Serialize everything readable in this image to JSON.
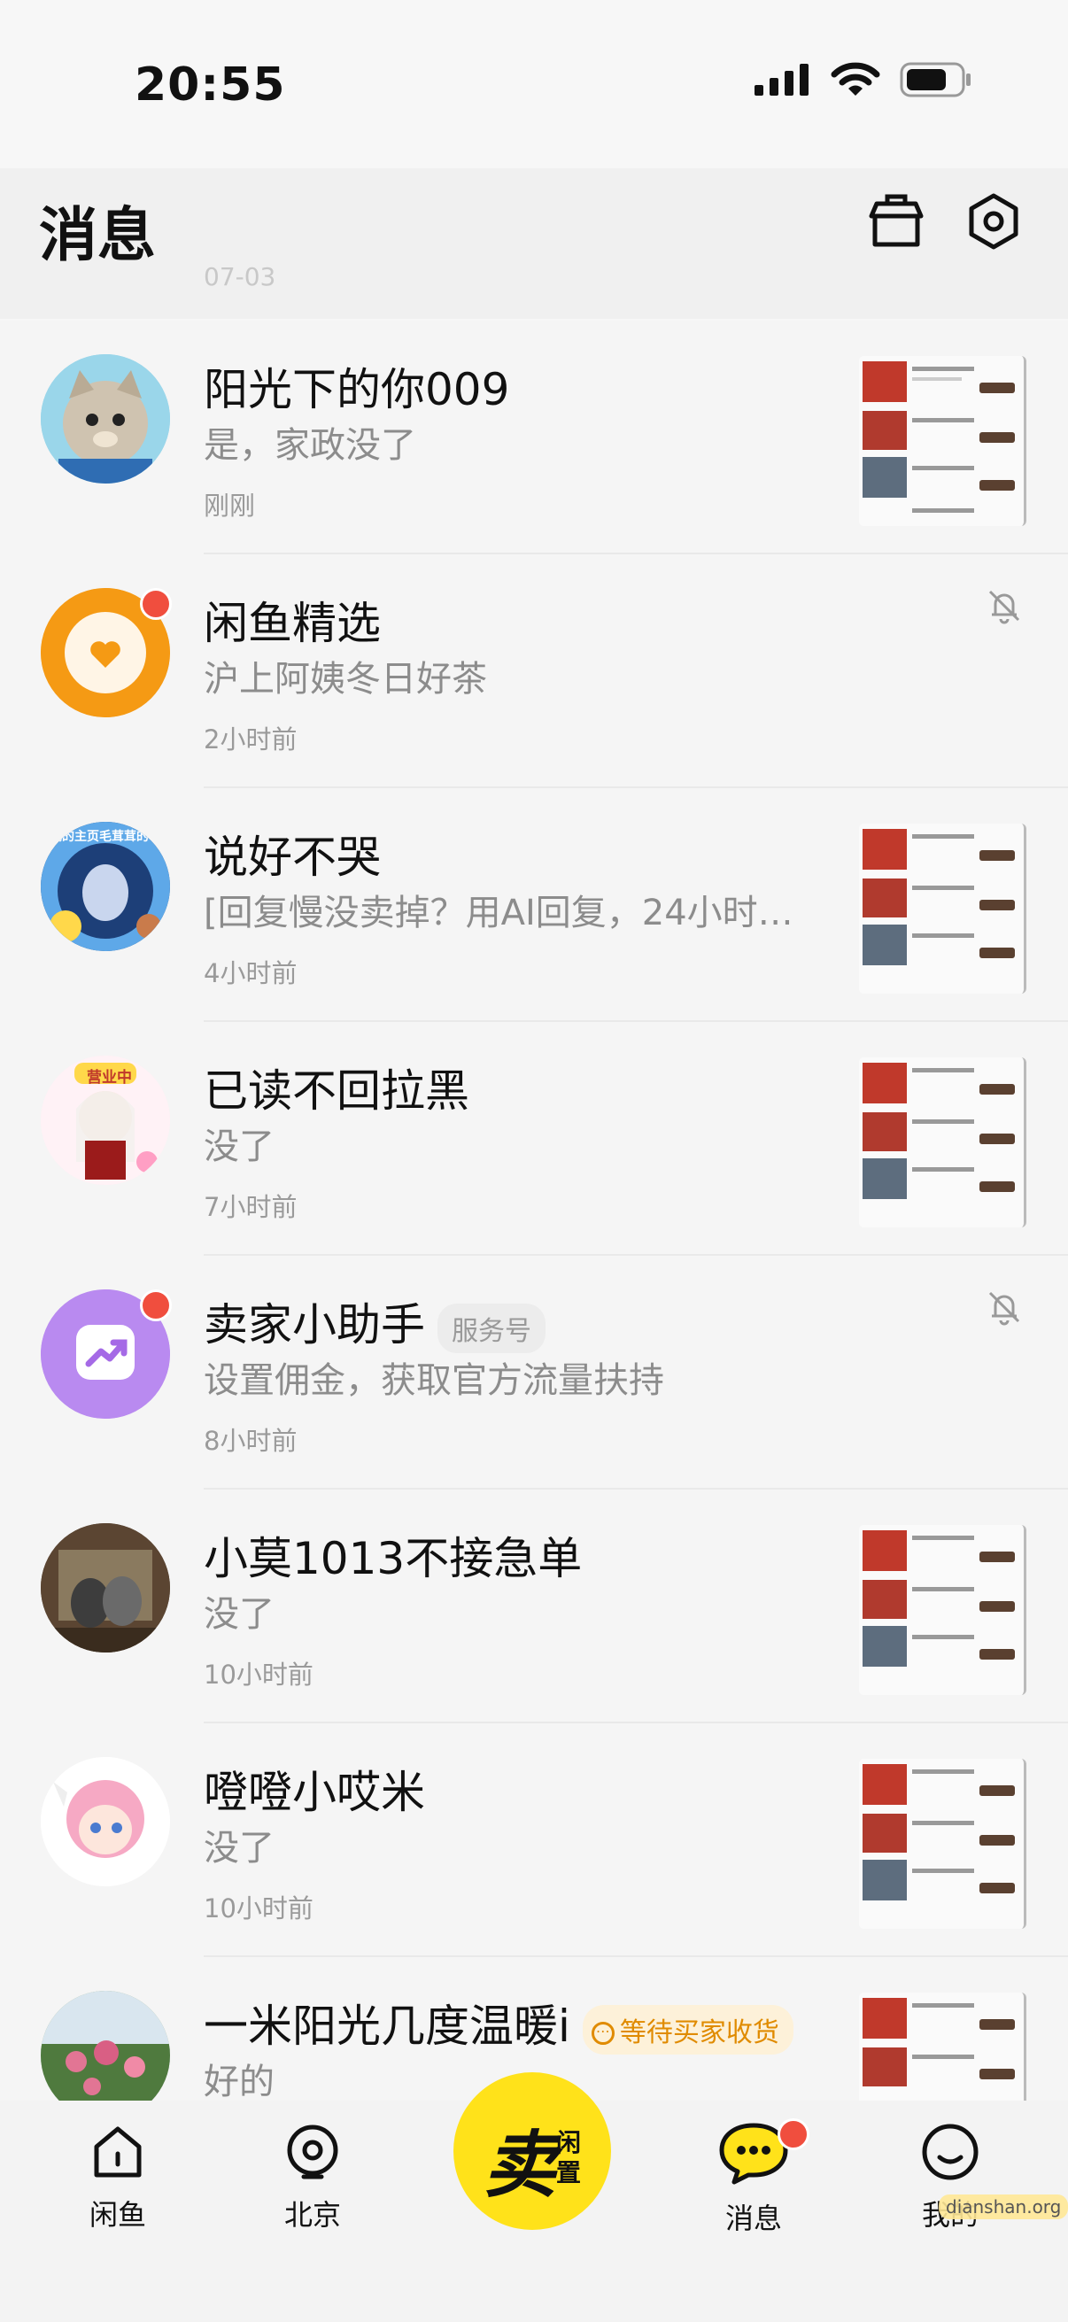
{
  "status": {
    "time": "20:55"
  },
  "header": {
    "title": "消息",
    "peek_text": "07-03"
  },
  "conversations": [
    {
      "name": "阳光下的你009",
      "preview": "是，家政没了",
      "time": "刚刚"
    },
    {
      "name": "闲鱼精选",
      "preview": "沪上阿姨冬日好茶",
      "time": "2小时前"
    },
    {
      "name": "说好不哭",
      "preview": "[回复慢没卖掉？用AI回复，24小时…",
      "time": "4小时前"
    },
    {
      "name": "已读不回拉黑",
      "preview": "没了",
      "time": "7小时前"
    },
    {
      "name": "卖家小助手",
      "tag": "服务号",
      "preview": "设置佣金，获取官方流量扶持",
      "time": "8小时前"
    },
    {
      "name": "小莫1013不接急单",
      "preview": "没了",
      "time": "10小时前"
    },
    {
      "name": "噔噔小哎米",
      "preview": "没了",
      "time": "10小时前"
    },
    {
      "name": "一米阳光几度温暖i",
      "tag": "等待买家收货",
      "preview": "好的",
      "time": ""
    }
  ],
  "avatar_texts": {
    "row2_banner": "我的主页毛茸茸的",
    "row3_badge": "营业中"
  },
  "tabbar": {
    "home": "闲鱼",
    "location": "北京",
    "sell_main": "卖",
    "sell_sub1": "闲",
    "sell_sub2": "置",
    "messages": "消息",
    "me": "我的"
  },
  "watermark": "dianshan.org",
  "colors": {
    "brand_yellow": "#ffe21a",
    "badge_red": "#f04e3e",
    "orange": "#f59a14",
    "purple": "#b98af0"
  }
}
